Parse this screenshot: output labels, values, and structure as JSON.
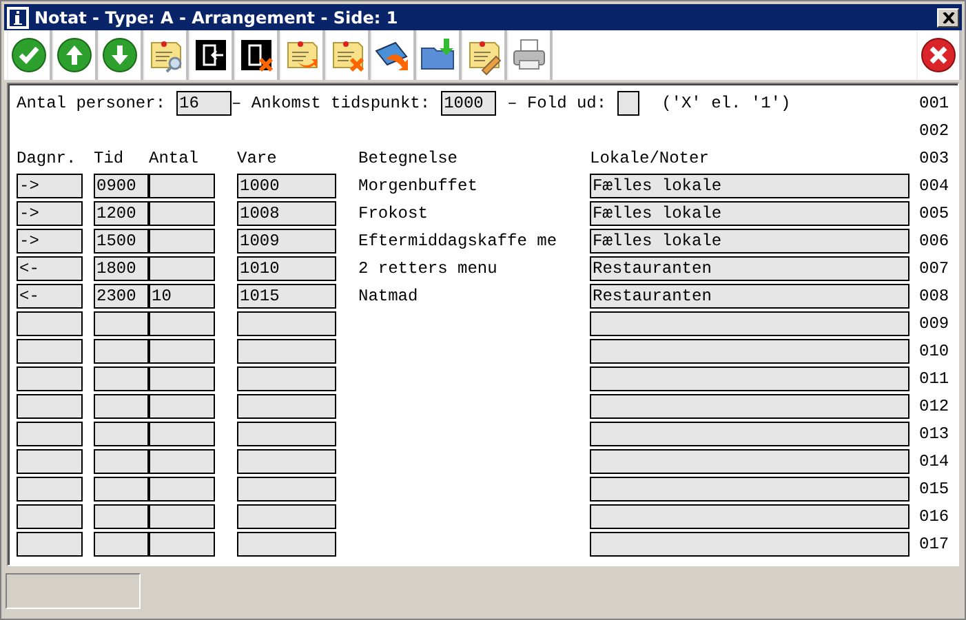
{
  "window": {
    "title": "Notat - Type: A - Arrangement - Side: 1"
  },
  "toolbar": [
    {
      "kind": "ok"
    },
    {
      "kind": "up"
    },
    {
      "kind": "down"
    },
    {
      "kind": "note-search"
    },
    {
      "kind": "exit"
    },
    {
      "kind": "exit-cancel"
    },
    {
      "kind": "note-arrow"
    },
    {
      "kind": "note-delete"
    },
    {
      "kind": "shape-arrow"
    },
    {
      "kind": "folder"
    },
    {
      "kind": "note-edit"
    },
    {
      "kind": "print"
    },
    {
      "kind": "cancel"
    }
  ],
  "header": {
    "persons_label": "Antal personer:",
    "persons": "16",
    "arrival_label": "– Ankomst tidspunkt:",
    "arrival": "1000",
    "fold_label": "– Fold ud:",
    "fold_hint": "('X' el. '1')",
    "line": "001"
  },
  "blank_line": "002",
  "columns": {
    "dagnr": "Dagnr.",
    "tid": "Tid",
    "antal": "Antal",
    "vare": "Vare",
    "betegnelse": "Betegnelse",
    "lokale": "Lokale/Noter",
    "line": "003"
  },
  "rows": [
    {
      "dagnr": "->",
      "tid": "0900",
      "antal": "",
      "vare": "1000",
      "betegnelse": "Morgenbuffet",
      "lokale": "Fælles lokale",
      "line": "004"
    },
    {
      "dagnr": "->",
      "tid": "1200",
      "antal": "",
      "vare": "1008",
      "betegnelse": "Frokost",
      "lokale": "Fælles lokale",
      "line": "005"
    },
    {
      "dagnr": "->",
      "tid": "1500",
      "antal": "",
      "vare": "1009",
      "betegnelse": "Eftermiddagskaffe me",
      "lokale": "Fælles lokale",
      "line": "006"
    },
    {
      "dagnr": "<-",
      "tid": "1800",
      "antal": "",
      "vare": "1010",
      "betegnelse": "2 retters menu",
      "lokale": "Restauranten",
      "line": "007"
    },
    {
      "dagnr": "<-",
      "tid": "2300",
      "antal": "10",
      "vare": "1015",
      "betegnelse": "Natmad",
      "lokale": "Restauranten",
      "line": "008"
    },
    {
      "dagnr": "",
      "tid": "",
      "antal": "",
      "vare": "",
      "betegnelse": "",
      "lokale": "",
      "line": "009"
    },
    {
      "dagnr": "",
      "tid": "",
      "antal": "",
      "vare": "",
      "betegnelse": "",
      "lokale": "",
      "line": "010"
    },
    {
      "dagnr": "",
      "tid": "",
      "antal": "",
      "vare": "",
      "betegnelse": "",
      "lokale": "",
      "line": "011"
    },
    {
      "dagnr": "",
      "tid": "",
      "antal": "",
      "vare": "",
      "betegnelse": "",
      "lokale": "",
      "line": "012"
    },
    {
      "dagnr": "",
      "tid": "",
      "antal": "",
      "vare": "",
      "betegnelse": "",
      "lokale": "",
      "line": "013"
    },
    {
      "dagnr": "",
      "tid": "",
      "antal": "",
      "vare": "",
      "betegnelse": "",
      "lokale": "",
      "line": "014"
    },
    {
      "dagnr": "",
      "tid": "",
      "antal": "",
      "vare": "",
      "betegnelse": "",
      "lokale": "",
      "line": "015"
    },
    {
      "dagnr": "",
      "tid": "",
      "antal": "",
      "vare": "",
      "betegnelse": "",
      "lokale": "",
      "line": "016"
    },
    {
      "dagnr": "",
      "tid": "",
      "antal": "",
      "vare": "",
      "betegnelse": "",
      "lokale": "",
      "line": "017"
    }
  ]
}
